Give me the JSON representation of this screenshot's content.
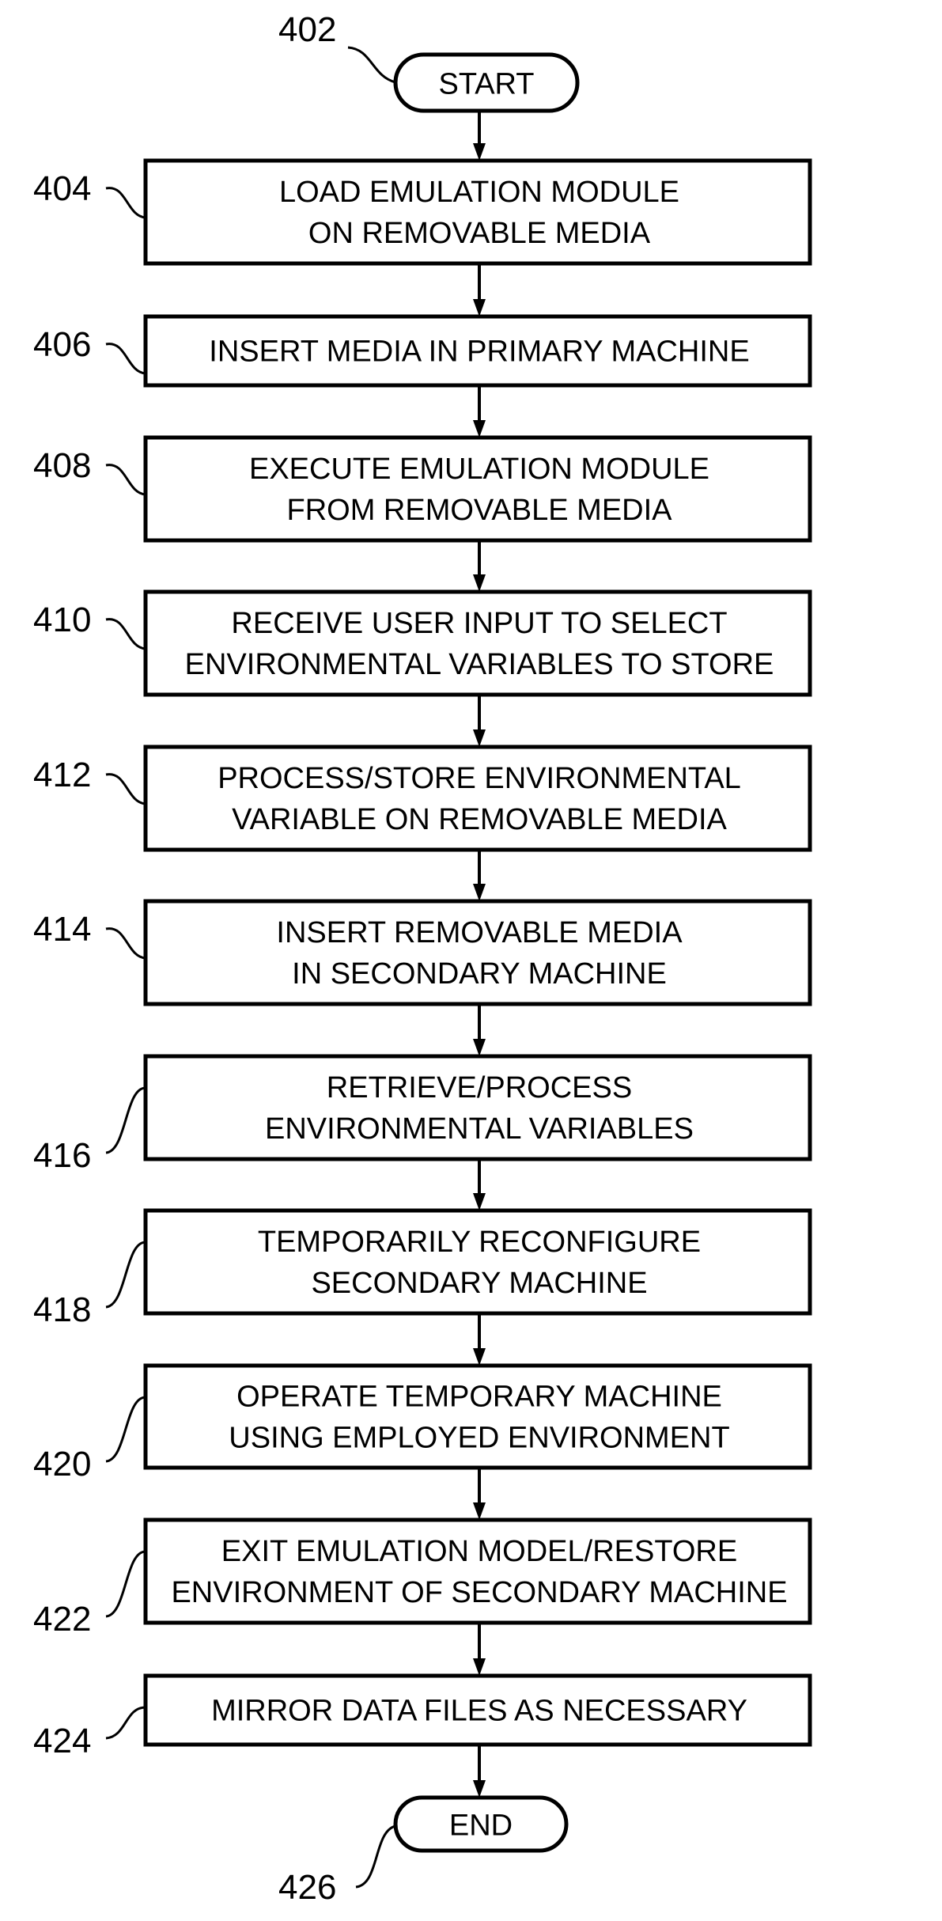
{
  "diagram": {
    "type": "flowchart",
    "start": {
      "ref": "402",
      "label": "START"
    },
    "steps": [
      {
        "ref": "404",
        "lines": [
          "LOAD EMULATION MODULE",
          "ON REMOVABLE MEDIA"
        ]
      },
      {
        "ref": "406",
        "lines": [
          "INSERT MEDIA IN PRIMARY MACHINE"
        ]
      },
      {
        "ref": "408",
        "lines": [
          "EXECUTE EMULATION MODULE",
          "FROM REMOVABLE MEDIA"
        ]
      },
      {
        "ref": "410",
        "lines": [
          "RECEIVE USER INPUT TO SELECT",
          "ENVIRONMENTAL VARIABLES TO STORE"
        ]
      },
      {
        "ref": "412",
        "lines": [
          "PROCESS/STORE ENVIRONMENTAL",
          "VARIABLE ON REMOVABLE MEDIA"
        ]
      },
      {
        "ref": "414",
        "lines": [
          "INSERT REMOVABLE MEDIA",
          "IN SECONDARY MACHINE"
        ]
      },
      {
        "ref": "416",
        "lines": [
          "RETRIEVE/PROCESS",
          "ENVIRONMENTAL VARIABLES"
        ]
      },
      {
        "ref": "418",
        "lines": [
          "TEMPORARILY RECONFIGURE",
          "SECONDARY MACHINE"
        ]
      },
      {
        "ref": "420",
        "lines": [
          "OPERATE TEMPORARY MACHINE",
          "USING EMPLOYED ENVIRONMENT"
        ]
      },
      {
        "ref": "422",
        "lines": [
          "EXIT EMULATION MODEL/RESTORE",
          "ENVIRONMENT OF SECONDARY MACHINE"
        ]
      },
      {
        "ref": "424",
        "lines": [
          "MIRROR DATA FILES AS NECESSARY"
        ]
      }
    ],
    "end": {
      "ref": "426",
      "label": "END"
    }
  }
}
